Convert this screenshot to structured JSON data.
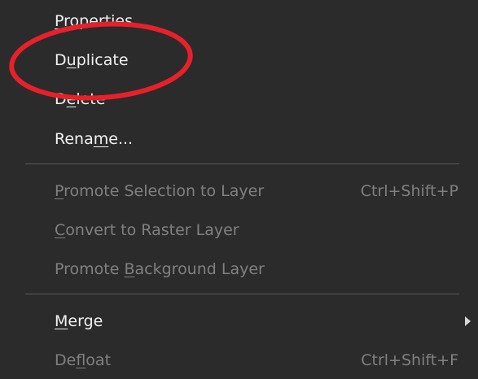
{
  "menu": {
    "items": [
      {
        "label": "Properties",
        "underline_index": 0,
        "shortcut": "",
        "disabled": false
      },
      {
        "label": "Duplicate",
        "underline_index": 1,
        "shortcut": "",
        "disabled": false
      },
      {
        "label": "Delete",
        "underline_index": 1,
        "shortcut": "",
        "disabled": false
      },
      {
        "label": "Rename...",
        "underline_index": 4,
        "shortcut": "",
        "disabled": false
      },
      {
        "label": "Promote Selection to Layer",
        "underline_index": 0,
        "shortcut": "Ctrl+Shift+P",
        "disabled": true
      },
      {
        "label": "Convert to Raster Layer",
        "underline_index": 0,
        "shortcut": "",
        "disabled": true
      },
      {
        "label": "Promote Background Layer",
        "underline_index": 8,
        "shortcut": "",
        "disabled": true
      },
      {
        "label": "Merge",
        "underline_index": 0,
        "shortcut": "",
        "disabled": false,
        "has_submenu": true
      },
      {
        "label": "Defloat",
        "underline_index": 2,
        "shortcut": "Ctrl+Shift+F",
        "disabled": true
      }
    ]
  },
  "annotation": {
    "shape": "ellipse",
    "color": "#e8202a",
    "highlighted_item": "Duplicate"
  },
  "colors": {
    "menu_background": "#2b2b2b",
    "enabled_text": "#f2f2f2",
    "disabled_text": "#808080",
    "separator": "#585858"
  }
}
